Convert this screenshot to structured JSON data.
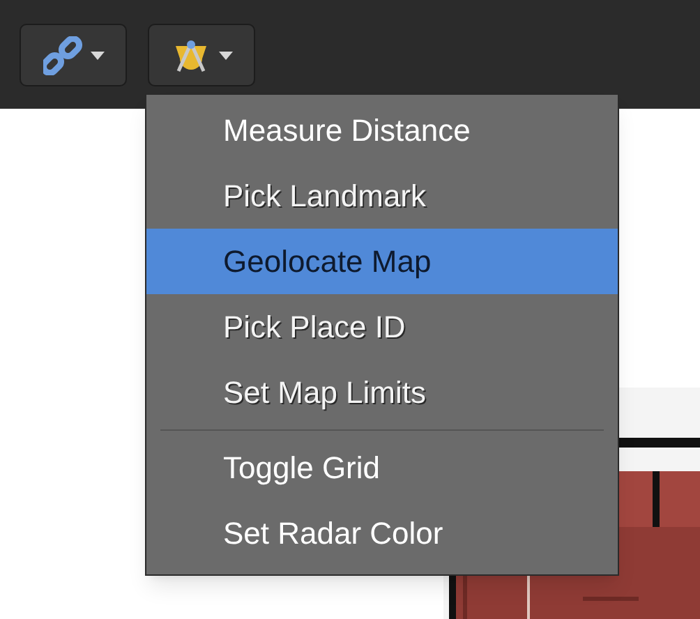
{
  "toolbar": {
    "buttons": [
      {
        "kind": "link"
      },
      {
        "kind": "compass"
      }
    ]
  },
  "menu": {
    "items": [
      {
        "kind": "item",
        "label": "Measure Distance",
        "disabled": false,
        "selected": false
      },
      {
        "kind": "item",
        "label": "Pick Landmark",
        "disabled": true,
        "selected": false
      },
      {
        "kind": "item",
        "label": "Geolocate Map",
        "disabled": false,
        "selected": true
      },
      {
        "kind": "item",
        "label": "Pick Place ID",
        "disabled": true,
        "selected": false
      },
      {
        "kind": "item",
        "label": "Set Map Limits",
        "disabled": true,
        "selected": false
      },
      {
        "kind": "separator"
      },
      {
        "kind": "item",
        "label": "Toggle Grid",
        "disabled": false,
        "selected": false
      },
      {
        "kind": "item",
        "label": "Set Radar Color",
        "disabled": false,
        "selected": false
      }
    ]
  }
}
